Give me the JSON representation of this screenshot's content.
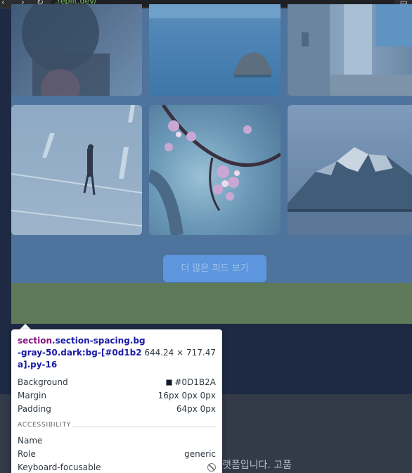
{
  "browser": {
    "url": ".replit.dev/"
  },
  "feed": {
    "images": [
      {
        "name": "person-in-dark-photo"
      },
      {
        "name": "sea-rock-photo"
      },
      {
        "name": "seaside-alley-photo"
      },
      {
        "name": "man-walking-road-photo"
      },
      {
        "name": "cherry-blossom-photo"
      },
      {
        "name": "snowy-mountain-lake-photo"
      }
    ],
    "more_button_label": "더 많은 피드 보기"
  },
  "devtools_tooltip": {
    "selector_tag": "section",
    "selector_classes": ".section-spacing.bg-gray-50.dark:bg-[#0d1b2a].py-16",
    "size": "644.24 × 717.47",
    "rows": [
      {
        "key": "Background",
        "value": "#0D1B2A"
      },
      {
        "key": "Margin",
        "value": "16px 0px 0px"
      },
      {
        "key": "Padding",
        "value": "64px 0px"
      }
    ],
    "accessibility_heading": "ACCESSIBILITY",
    "a11y_rows": [
      {
        "key": "Name",
        "value": ""
      },
      {
        "key": "Role",
        "value": "generic"
      },
      {
        "key": "Keyboard-focusable",
        "value": ""
      }
    ]
  },
  "footer": {
    "text": "랫폼입니다. 고품"
  },
  "colors": {
    "section_overlay": "#4e739c",
    "margin_highlight": "#5e7a58",
    "background_swatch": "#0D1B2A",
    "button": "#5d96dc"
  }
}
